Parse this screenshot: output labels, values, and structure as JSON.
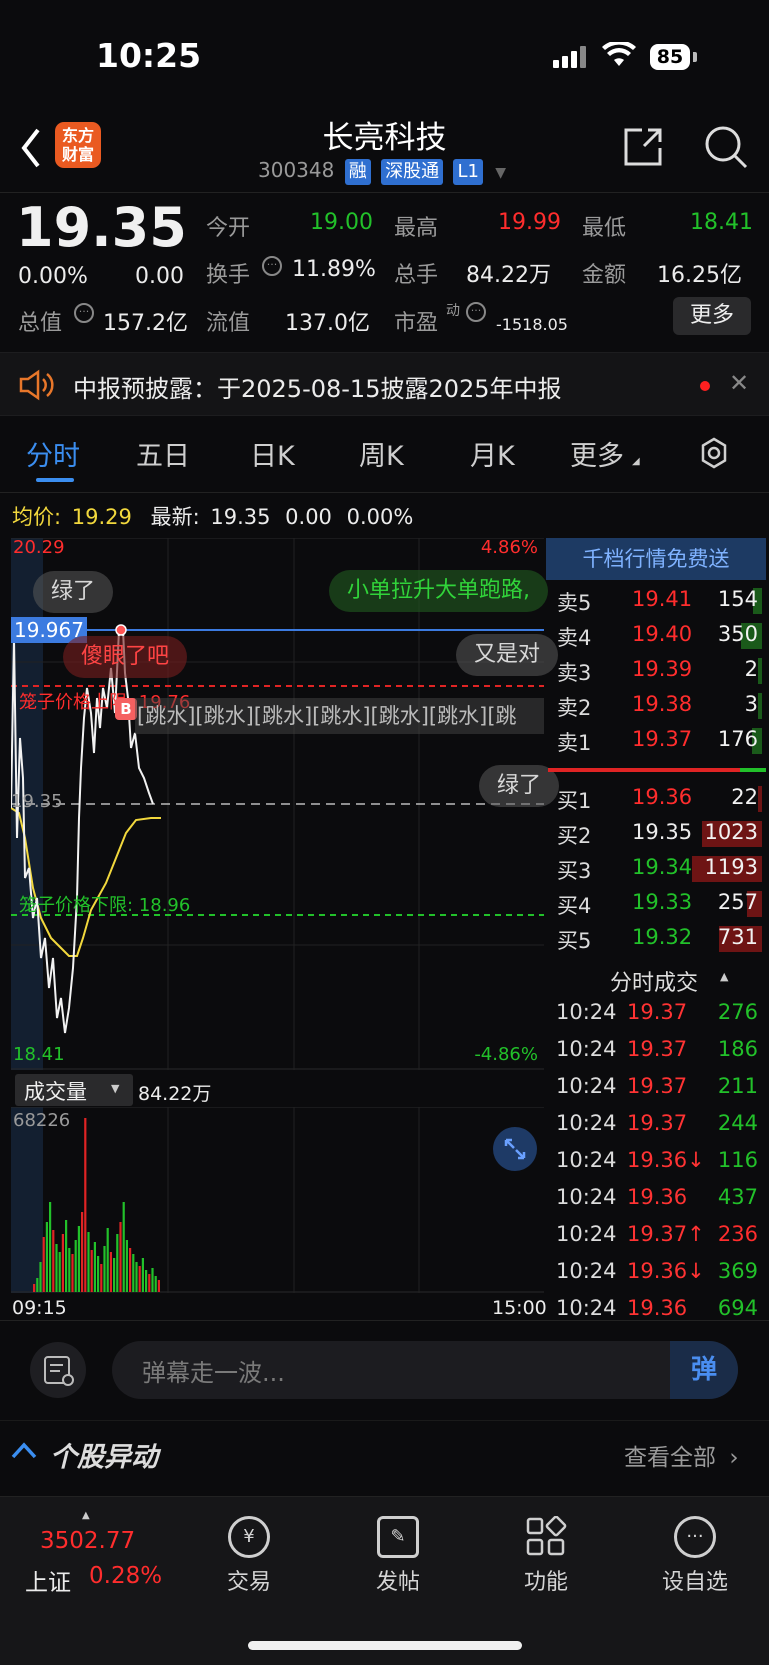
{
  "status": {
    "time": "10:25",
    "battery": "85"
  },
  "header": {
    "logo_line1": "东方",
    "logo_line2": "财富",
    "name": "长亮科技",
    "code": "300348",
    "tags": [
      "融",
      "深股通",
      "L1"
    ]
  },
  "quote": {
    "price": "19.35",
    "change_pct": "0.00%",
    "change": "0.00",
    "open_label": "今开",
    "open": "19.00",
    "high_label": "最高",
    "high": "19.99",
    "low_label": "最低",
    "low": "18.41",
    "turnover_label": "换手",
    "turnover": "11.89%",
    "volume_label": "总手",
    "volume": "84.22万",
    "amount_label": "金额",
    "amount": "16.25亿",
    "mktcap_label": "总值",
    "mktcap": "157.2亿",
    "float_label": "流值",
    "float": "137.0亿",
    "pe_label": "市盈",
    "pe_sup": "动",
    "pe": "-1518.05",
    "more_button": "更多"
  },
  "notice": {
    "text": "中报预披露：于2025-08-15披露2025年中报"
  },
  "tabs": [
    "分时",
    "五日",
    "日K",
    "周K",
    "月K",
    "更多"
  ],
  "chart": {
    "avg_label": "均价:",
    "avg": "19.29",
    "latest_label": "最新:",
    "latest": "19.35",
    "latest_chg": "0.00",
    "latest_pct": "0.00%",
    "y_top": "20.29",
    "y_bottom": "18.41",
    "pct_top": "4.86%",
    "pct_bottom": "-4.86%",
    "marker_price": "19.967",
    "ref_price": "19.35",
    "upper_limit_label": "笼子价格上限: 19.76",
    "lower_limit_label": "笼子价格下限: 18.96",
    "b_marker": "B"
  },
  "danmaku": [
    "绿了",
    "小单拉升大单跑路,",
    "傻眼了吧",
    "又是对",
    "[跳水][跳水][跳水][跳水][跳水][跳水][跳",
    "绿了"
  ],
  "volume": {
    "selector": "成交量",
    "total": "84.22万",
    "max": "68226",
    "time_start": "09:15",
    "time_end": "15:00"
  },
  "orderbook": {
    "promo": "千档行情免费送",
    "asks": [
      {
        "label": "卖5",
        "price": "19.41",
        "qty": "154"
      },
      {
        "label": "卖4",
        "price": "19.40",
        "qty": "350"
      },
      {
        "label": "卖3",
        "price": "19.39",
        "qty": "2"
      },
      {
        "label": "卖2",
        "price": "19.38",
        "qty": "3"
      },
      {
        "label": "卖1",
        "price": "19.37",
        "qty": "176"
      }
    ],
    "bids": [
      {
        "label": "买1",
        "price": "19.36",
        "qty": "22"
      },
      {
        "label": "买2",
        "price": "19.35",
        "qty": "1023"
      },
      {
        "label": "买3",
        "price": "19.34",
        "qty": "1193"
      },
      {
        "label": "买4",
        "price": "19.33",
        "qty": "257"
      },
      {
        "label": "买5",
        "price": "19.32",
        "qty": "731"
      }
    ],
    "trades_title": "分时成交",
    "trades": [
      {
        "time": "10:24",
        "price": "19.37",
        "vol": "276",
        "vol_color": "green"
      },
      {
        "time": "10:24",
        "price": "19.37",
        "vol": "186",
        "vol_color": "green"
      },
      {
        "time": "10:24",
        "price": "19.37",
        "vol": "211",
        "vol_color": "green"
      },
      {
        "time": "10:24",
        "price": "19.37",
        "vol": "244",
        "vol_color": "green"
      },
      {
        "time": "10:24",
        "price": "19.36↓",
        "vol": "116",
        "vol_color": "green"
      },
      {
        "time": "10:24",
        "price": "19.36",
        "vol": "437",
        "vol_color": "green"
      },
      {
        "time": "10:24",
        "price": "19.37↑",
        "vol": "236",
        "vol_color": "red"
      },
      {
        "time": "10:24",
        "price": "19.36↓",
        "vol": "369",
        "vol_color": "green"
      },
      {
        "time": "10:24",
        "price": "19.36",
        "vol": "694",
        "vol_color": "green"
      }
    ]
  },
  "comment": {
    "placeholder": "弹幕走一波...",
    "send": "弹"
  },
  "section": {
    "title": "个股异动",
    "link": "查看全部"
  },
  "bottom": {
    "index_value": "3502.77",
    "index_name": "上证",
    "index_pct": "0.28%",
    "nav": [
      "交易",
      "发帖",
      "功能",
      "设自选"
    ]
  }
}
